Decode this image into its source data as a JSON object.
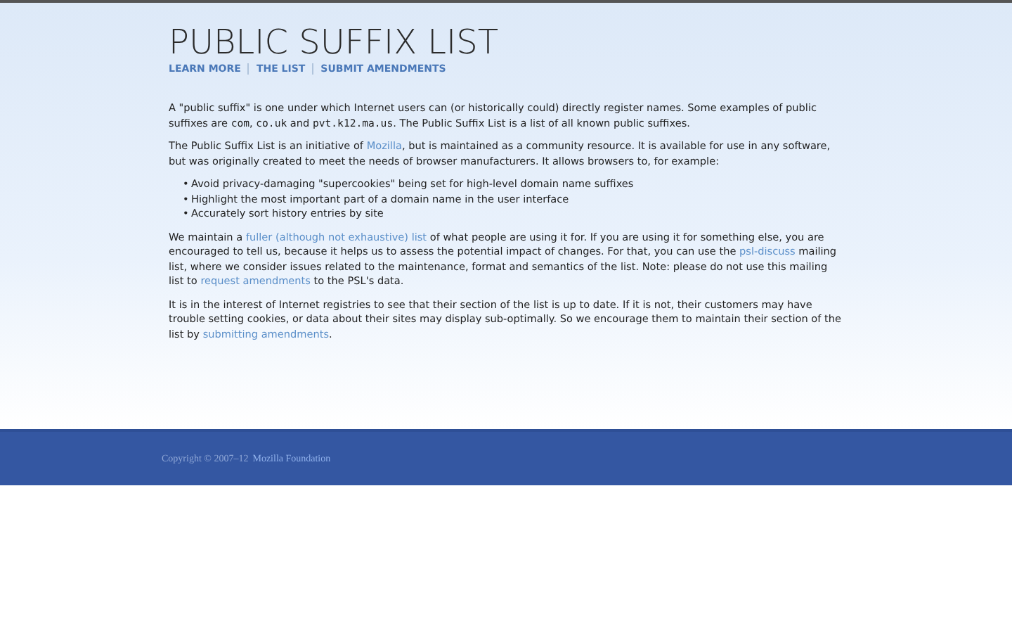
{
  "header": {
    "title": "PUBLIC SUFFIX LIST",
    "nav": [
      "LEARN MORE",
      "THE LIST",
      "SUBMIT AMENDMENTS"
    ]
  },
  "paragraphs_before": [
    [
      {
        "kind": "text",
        "text": "A \"public suffix\" is one under which Internet users can (or historically could) directly register names. Some examples of public suffixes are "
      },
      {
        "kind": "code",
        "text": "com"
      },
      {
        "kind": "text",
        "text": ", "
      },
      {
        "kind": "code",
        "text": "co.uk"
      },
      {
        "kind": "text",
        "text": " and "
      },
      {
        "kind": "code",
        "text": "pvt.k12.ma.us"
      },
      {
        "kind": "text",
        "text": ". The Public Suffix List is a list of all known public suffixes."
      }
    ],
    [
      {
        "kind": "text",
        "text": "The Public Suffix List is an initiative of "
      },
      {
        "kind": "link",
        "text": "Mozilla"
      },
      {
        "kind": "text",
        "text": ", but is maintained as a community resource. It is available for use in any software, but was originally created to meet the needs of browser manufacturers. It allows browsers to, for example:"
      }
    ]
  ],
  "bullets": [
    {
      "marker": "•",
      "text": "Avoid privacy-damaging \"supercookies\" being set for high-level domain name suffixes"
    },
    {
      "marker": "•",
      "text": "Highlight the most important part of a domain name in the user interface"
    },
    {
      "marker": "•",
      "text": "Accurately sort history entries by site"
    }
  ],
  "paragraphs_after": [
    [
      {
        "kind": "text",
        "text": "We maintain a "
      },
      {
        "kind": "link",
        "text": "fuller (although not exhaustive) list"
      },
      {
        "kind": "text",
        "text": " of what people are using it for. If you are using it for something else, you are encouraged to tell us, because it helps us to assess the potential impact of changes. For that, you can use the "
      },
      {
        "kind": "link",
        "text": "psl-discuss"
      },
      {
        "kind": "text",
        "text": " mailing list, where we consider issues related to the maintenance, format and semantics of the list. Note: please do not use this mailing list to "
      },
      {
        "kind": "link",
        "text": "request amendments"
      },
      {
        "kind": "text",
        "text": " to the PSL's data."
      }
    ],
    [
      {
        "kind": "text",
        "text": "It is in the interest of Internet registries to see that their section of the list is up to date. If it is not, their customers may have trouble setting cookies, or data about their sites may display sub-optimally. So we encourage them to maintain their section of the list by "
      },
      {
        "kind": "link",
        "text": "submitting amendments"
      },
      {
        "kind": "text",
        "text": "."
      }
    ]
  ],
  "footer": {
    "copyright": "Copyright © 2007–12",
    "link": "Mozilla Foundation"
  }
}
